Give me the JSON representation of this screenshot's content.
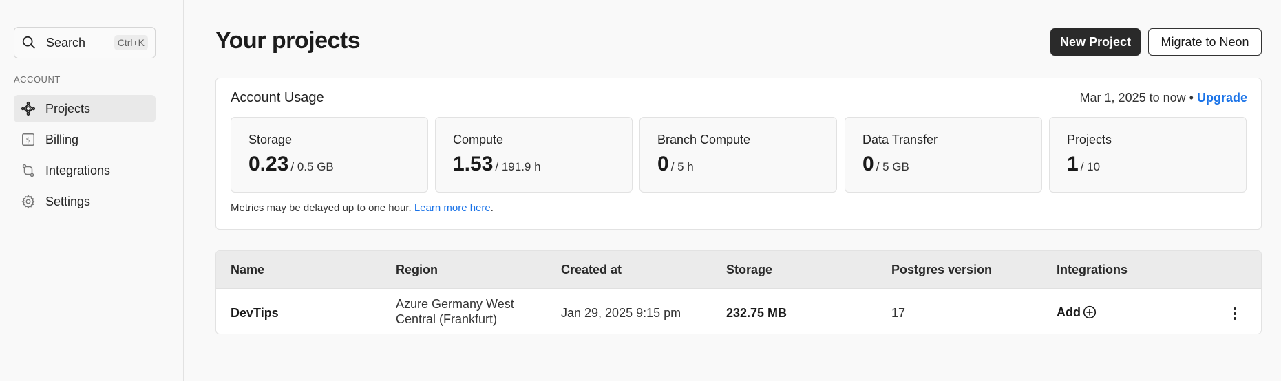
{
  "sidebar": {
    "search": {
      "label": "Search",
      "shortcut": "Ctrl+K"
    },
    "section_label": "ACCOUNT",
    "items": [
      {
        "label": "Projects",
        "icon": "projects-icon",
        "active": true
      },
      {
        "label": "Billing",
        "icon": "billing-icon",
        "active": false
      },
      {
        "label": "Integrations",
        "icon": "integrations-icon",
        "active": false
      },
      {
        "label": "Settings",
        "icon": "gear-icon",
        "active": false
      }
    ]
  },
  "header": {
    "title": "Your projects",
    "new_project_label": "New Project",
    "migrate_label": "Migrate to Neon"
  },
  "usage": {
    "title": "Account Usage",
    "range": "Mar 1, 2025 to now",
    "separator": "•",
    "upgrade_label": "Upgrade",
    "metrics": [
      {
        "label": "Storage",
        "value": "0.23",
        "limit": "/ 0.5 GB"
      },
      {
        "label": "Compute",
        "value": "1.53",
        "limit": "/ 191.9 h"
      },
      {
        "label": "Branch Compute",
        "value": "0",
        "limit": "/ 5 h"
      },
      {
        "label": "Data Transfer",
        "value": "0",
        "limit": "/ 5 GB"
      },
      {
        "label": "Projects",
        "value": "1",
        "limit": "/ 10"
      }
    ],
    "note": "Metrics may be delayed up to one hour.",
    "note_link": "Learn more here",
    "note_end": "."
  },
  "table": {
    "columns": [
      "Name",
      "Region",
      "Created at",
      "Storage",
      "Postgres version",
      "Integrations"
    ],
    "rows": [
      {
        "name": "DevTips",
        "region_line1": "Azure Germany West",
        "region_line2": "Central (Frankfurt)",
        "created_at": "Jan 29, 2025 9:15 pm",
        "storage": "232.75 MB",
        "postgres_version": "17",
        "integrations_label": "Add"
      }
    ]
  },
  "colors": {
    "accent_link": "#1a73e8",
    "primary_button": "#2a2a2a",
    "active_nav_bg": "#e9e9e9"
  }
}
